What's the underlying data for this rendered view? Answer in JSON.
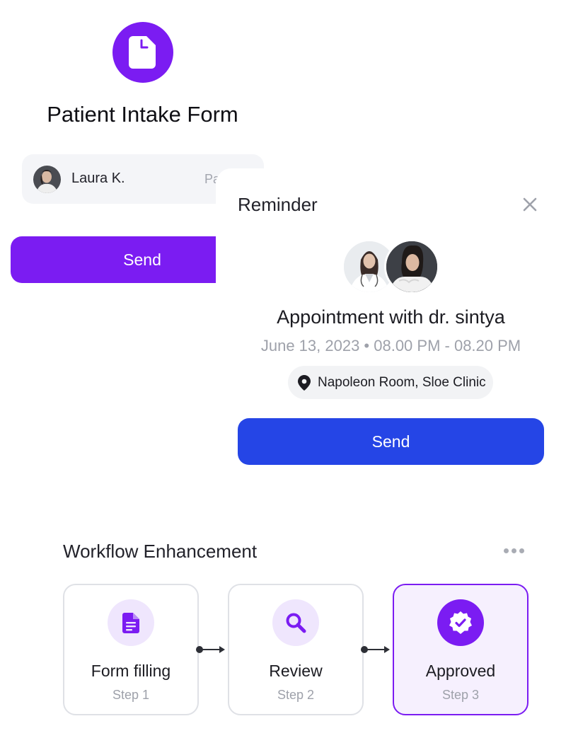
{
  "intake": {
    "title": "Patient Intake Form",
    "patient_name": "Laura K.",
    "patient_role_fragment": "Pa",
    "send_label": "Send"
  },
  "reminder": {
    "title": "Reminder",
    "appointment_title": "Appointment with dr. sintya",
    "appointment_time": "June 13, 2023 • 08.00 PM - 08.20 PM",
    "location": "Napoleon Room, Sloe Clinic",
    "send_label": "Send"
  },
  "workflow": {
    "title": "Workflow Enhancement",
    "steps": [
      {
        "label": "Form filling",
        "sub": "Step 1",
        "icon": "document-icon"
      },
      {
        "label": "Review",
        "sub": "Step 2",
        "icon": "search-icon"
      },
      {
        "label": "Approved",
        "sub": "Step 3",
        "icon": "verified-badge-icon"
      }
    ]
  },
  "colors": {
    "purple": "#7b1cf2",
    "blue": "#2545e6",
    "light_purple": "#efe6fd"
  }
}
